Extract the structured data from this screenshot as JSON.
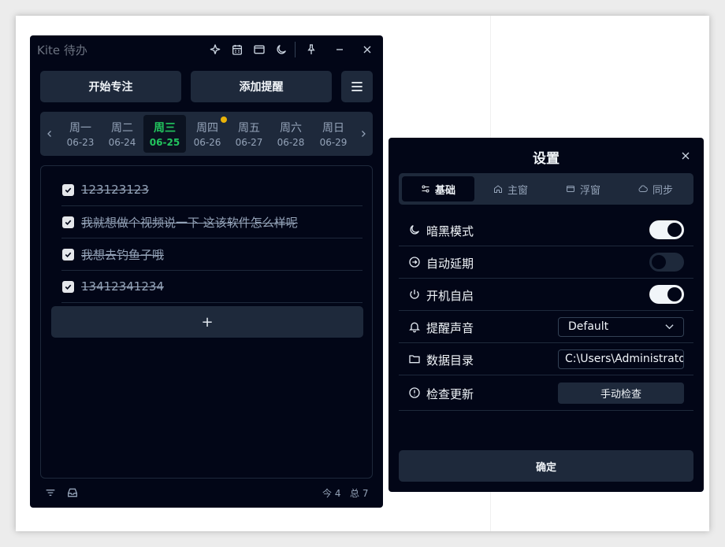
{
  "main": {
    "title": "Kite 待办",
    "toolbar_icons": [
      "sparkle-icon",
      "calendar-icon",
      "window-icon",
      "moon-icon",
      "pin-icon",
      "minimize-icon",
      "close-icon"
    ],
    "focus_label": "开始专注",
    "reminder_label": "添加提醒",
    "week": {
      "days": [
        {
          "name": "周一",
          "date": "06-23"
        },
        {
          "name": "周二",
          "date": "06-24"
        },
        {
          "name": "周三",
          "date": "06-25"
        },
        {
          "name": "周四",
          "date": "06-26"
        },
        {
          "name": "周五",
          "date": "06-27"
        },
        {
          "name": "周六",
          "date": "06-28"
        },
        {
          "name": "周日",
          "date": "06-29"
        }
      ],
      "active_index": 2,
      "dot_index": 3
    },
    "todos": [
      {
        "text": "123123123",
        "done": true
      },
      {
        "text": "我就想做个视频说一下 这该软件怎么样呢",
        "done": true
      },
      {
        "text": "我想去钓鱼子哦",
        "done": true
      },
      {
        "text": "13412341234",
        "done": true
      }
    ],
    "add_label": "+",
    "footer": {
      "today_label": "今 4",
      "total_label": "总 7"
    }
  },
  "settings": {
    "title": "设置",
    "tabs": [
      {
        "label": "基础",
        "icon": "sliders-icon"
      },
      {
        "label": "主窗",
        "icon": "home-icon"
      },
      {
        "label": "浮窗",
        "icon": "window-icon"
      },
      {
        "label": "同步",
        "icon": "cloud-icon"
      }
    ],
    "active_tab": 0,
    "rows": {
      "dark_mode": {
        "label": "暗黑模式",
        "on": true
      },
      "auto_postpone": {
        "label": "自动延期",
        "on": false
      },
      "autostart": {
        "label": "开机自启",
        "on": true
      },
      "sound": {
        "label": "提醒声音",
        "value": "Default"
      },
      "data_dir": {
        "label": "数据目录",
        "value": "C:\\Users\\Administrator"
      },
      "update": {
        "label": "检查更新",
        "button": "手动检查"
      }
    },
    "ok_label": "确定"
  },
  "colors": {
    "window_bg": "#020617",
    "panel_bg": "#1e293b",
    "active_day": "#22c55e",
    "dot": "#eab308"
  }
}
